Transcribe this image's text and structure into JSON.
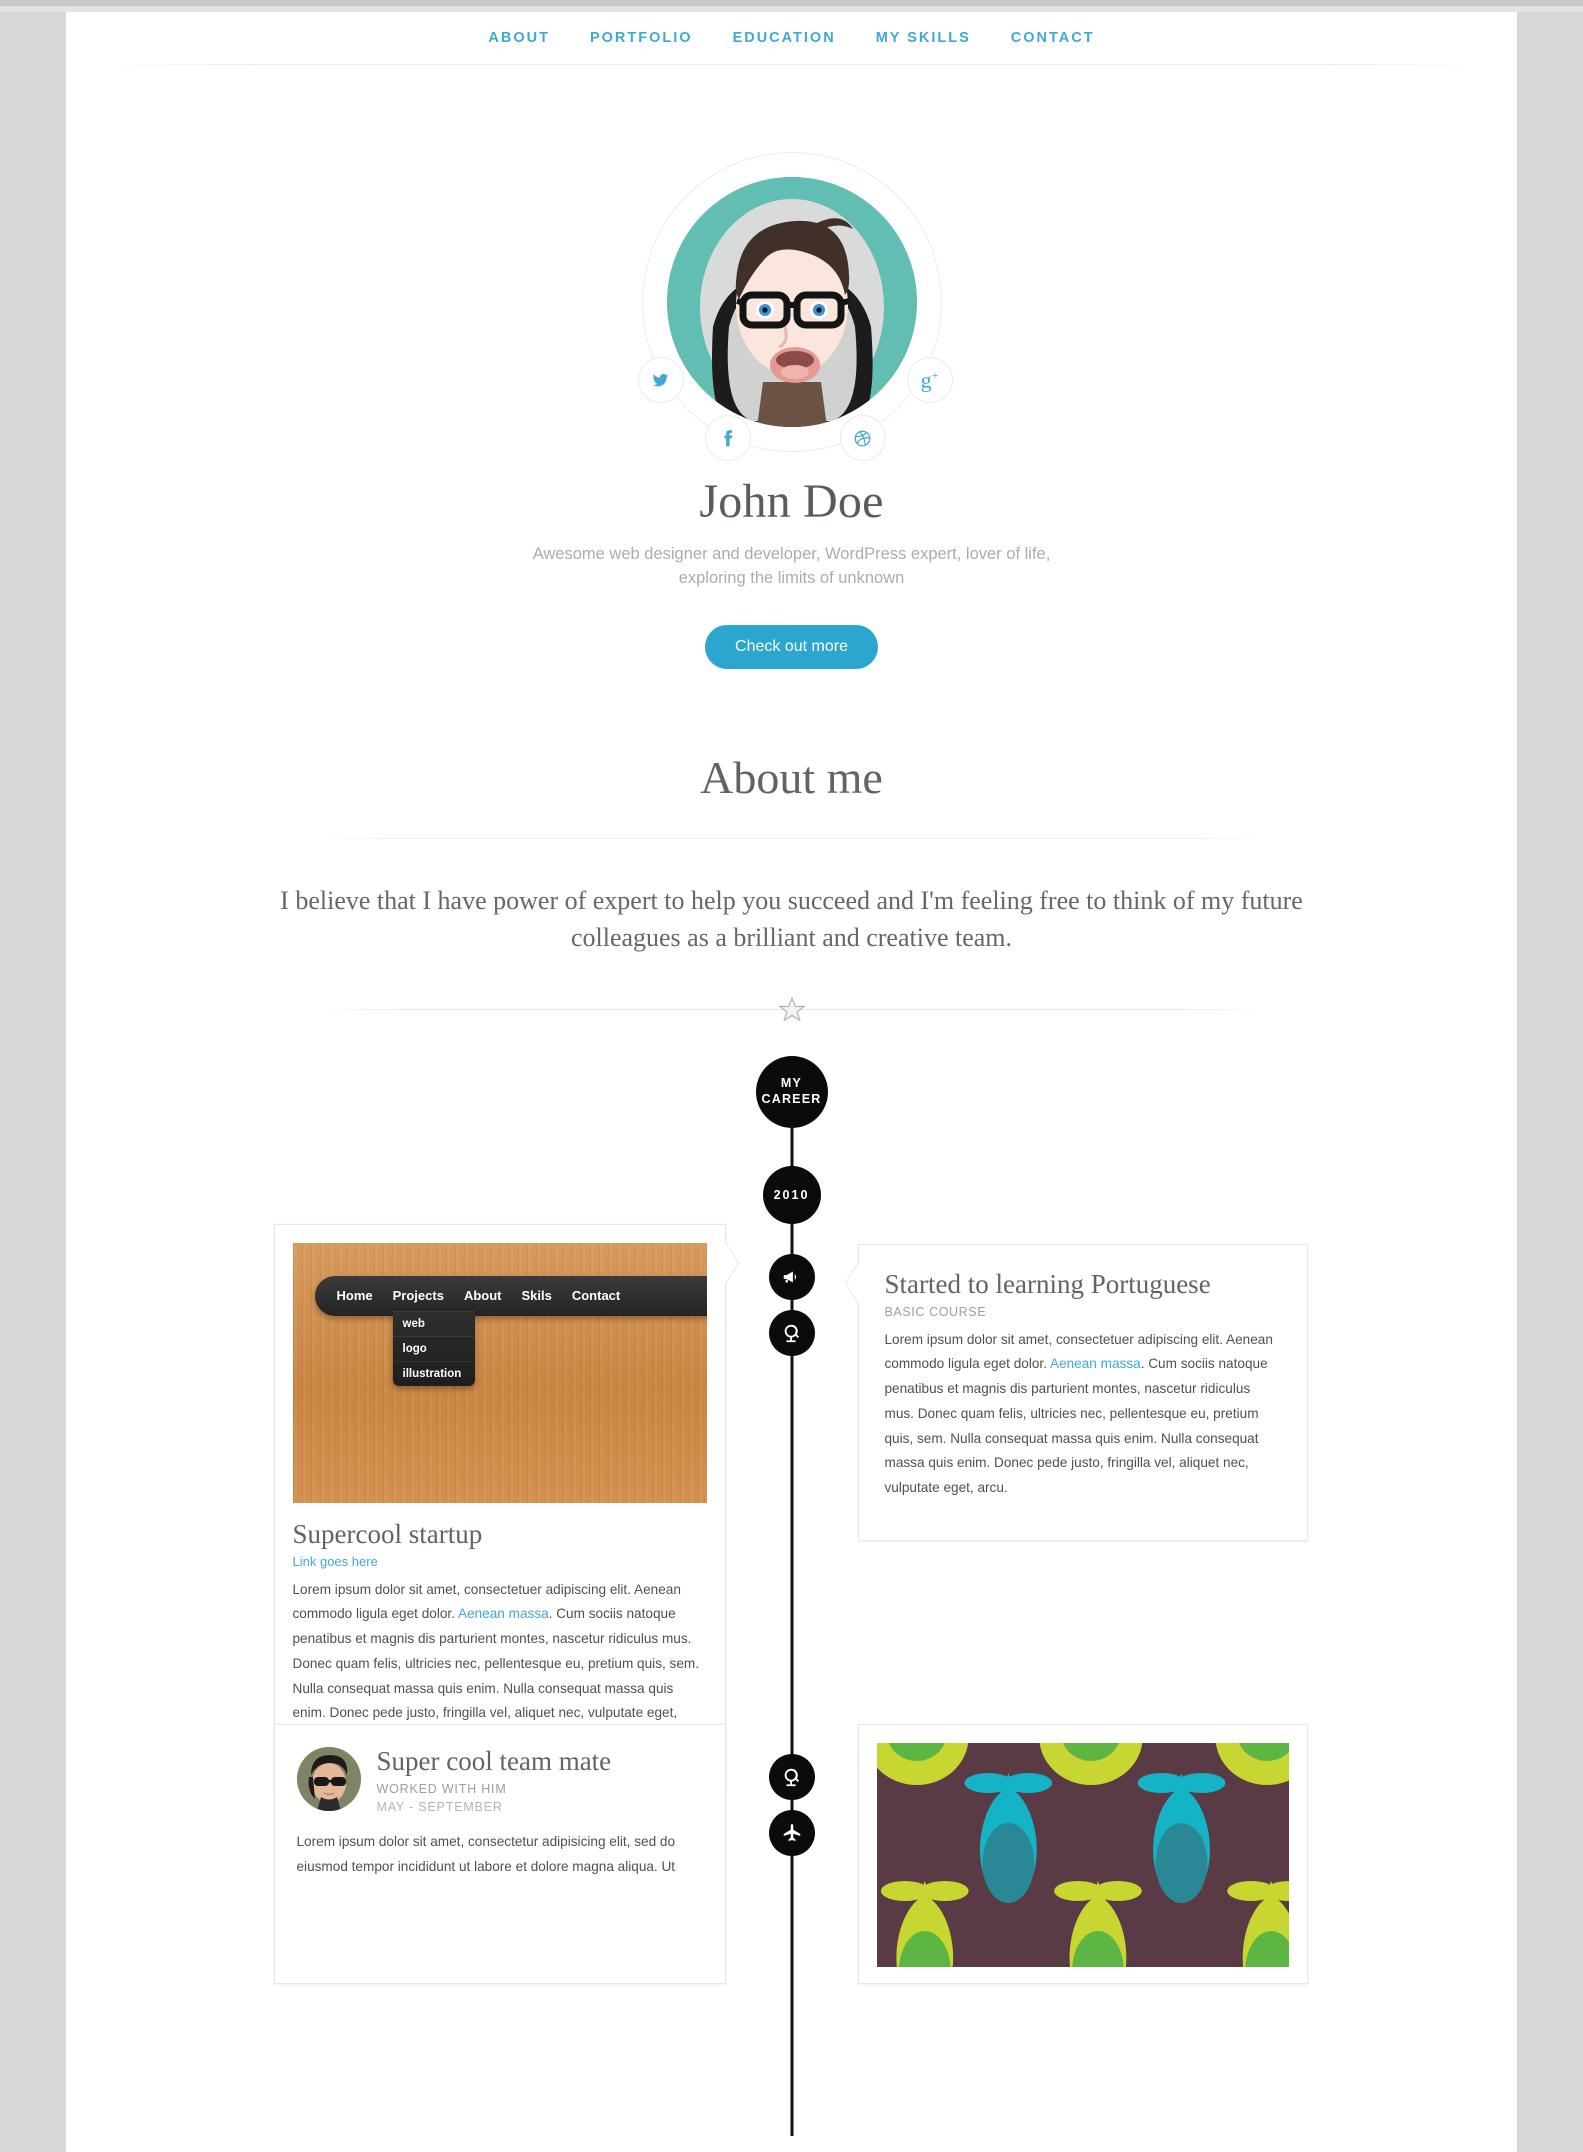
{
  "nav": {
    "items": [
      {
        "label": "ABOUT"
      },
      {
        "label": "PORTFOLIO"
      },
      {
        "label": "EDUCATION"
      },
      {
        "label": "MY SKILLS"
      },
      {
        "label": "CONTACT"
      }
    ]
  },
  "hero": {
    "name": "John Doe",
    "tagline": "Awesome web designer and developer, WordPress expert, lover of life, exploring the limits of unknown",
    "cta_label": "Check out more",
    "social": [
      {
        "name": "twitter",
        "glyph": "t"
      },
      {
        "name": "facebook",
        "glyph": "f"
      },
      {
        "name": "dribbble",
        "glyph": "d"
      },
      {
        "name": "googleplus",
        "glyph": "g+"
      }
    ]
  },
  "about": {
    "heading": "About me",
    "lead": "I believe that I have power of expert to help you succeed and I'm feeling free to think of my future colleagues as a brilliant and creative team."
  },
  "timeline": {
    "career_line1": "MY",
    "career_line2": "CAREER",
    "year": "2010",
    "nodes": [
      {
        "icon": "megaphone-icon"
      },
      {
        "icon": "globe-icon"
      },
      {
        "icon": "globe-icon"
      },
      {
        "icon": "plane-icon"
      }
    ],
    "cards": [
      {
        "side": "right",
        "title": "Started to learning Portuguese",
        "subtitle": "BASIC COURSE",
        "body_a": "Lorem ipsum dolor sit amet, consectetuer adipiscing elit. Aenean commodo ligula eget dolor. ",
        "body_link": "Aenean massa",
        "body_b": ". Cum sociis natoque penatibus et magnis dis parturient montes, nascetur ridiculus mus. Donec quam felis, ultricies nec, pellentesque eu, pretium quis, sem. Nulla consequat massa quis enim. Nulla consequat massa quis enim. Donec pede justo, fringilla vel, aliquet nec, vulputate eget, arcu."
      },
      {
        "side": "left",
        "title": "Supercool startup",
        "link_label": "Link goes here",
        "body_a": "Lorem ipsum dolor sit amet, consectetuer adipiscing elit. Aenean commodo ligula eget dolor. ",
        "body_link": "Aenean massa",
        "body_b": ". Cum sociis natoque penatibus et magnis dis parturient montes, nascetur ridiculus mus. Donec quam felis, ultricies nec, pellentesque eu, pretium quis, sem. Nulla consequat massa quis enim. Nulla consequat massa quis enim. Donec pede justo, fringilla vel, aliquet nec, vulputate eget, arcu.",
        "thumb_nav": [
          "Home",
          "Projects",
          "About",
          "Skils",
          "Contact"
        ],
        "thumb_dropdown": [
          "web",
          "logo",
          "illustration"
        ]
      },
      {
        "side": "left",
        "title": "Super cool team mate",
        "subtitle": "WORKED WITH HIM",
        "date": "MAY - SEPTEMBER",
        "body_a": "Lorem ipsum dolor sit amet, consectetur adipisicing elit, sed do eiusmod tempor incididunt ut labore et dolore magna aliqua. Ut"
      }
    ]
  },
  "colors": {
    "accent": "#3fa9d4",
    "button": "#2ba6cf",
    "node": "#0b0b0b",
    "heading": "#5e646a",
    "muted": "#a8adb1"
  }
}
